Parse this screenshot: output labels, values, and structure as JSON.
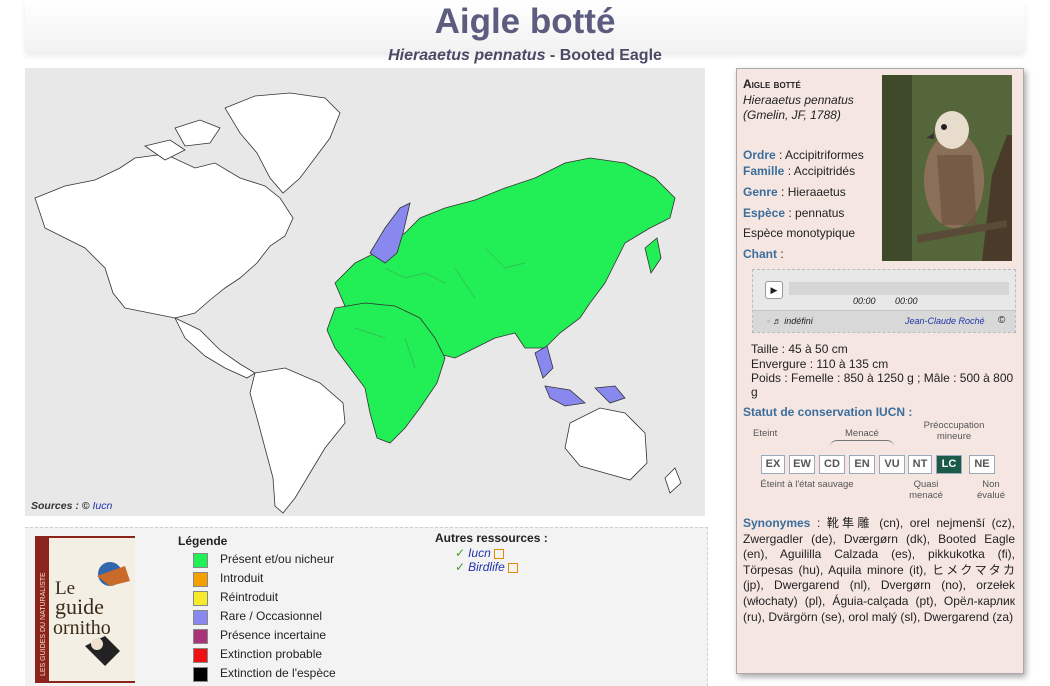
{
  "header": {
    "title": "Aigle botté",
    "subtitle_sci": "Hieraaetus pennatus",
    "subtitle_sep": " - ",
    "subtitle_common": "Booted Eagle"
  },
  "map": {
    "sources_label": "Sources : ©",
    "sources_link": "Iucn"
  },
  "legend": {
    "title": "Légende",
    "items": [
      {
        "label": "Présent et/ou nicheur",
        "color": "#22ee55"
      },
      {
        "label": "Introduit",
        "color": "#f3a000"
      },
      {
        "label": "Réintroduit",
        "color": "#f6ea2a"
      },
      {
        "label": "Rare / Occasionnel",
        "color": "#8888ee"
      },
      {
        "label": "Présence incertaine",
        "color": "#aa3377"
      },
      {
        "label": "Extinction probable",
        "color": "#ee1111"
      },
      {
        "label": "Extinction de l'espèce",
        "color": "#000000"
      }
    ]
  },
  "resources": {
    "title": "Autres ressources :",
    "items": [
      "Iucn",
      "Birdlife"
    ]
  },
  "book": {
    "title_l1": "Le",
    "title_l2": "guide",
    "title_l3": "ornitho",
    "spine": "LES GUIDES DU NATURALISTE"
  },
  "card": {
    "name": "Aigle botté",
    "sci_name": "Hieraaetus pennatus",
    "author": "(Gmelin, JF, 1788)",
    "ordre_label": "Ordre",
    "ordre_value": ": Accipitriformes",
    "famille_label": "Famille",
    "famille_value": ": Accipitridés",
    "genre_label": "Genre",
    "genre_value": ": Hieraaetus",
    "espece_label": "Espèce",
    "espece_value": ": pennatus",
    "monotypique": "Espèce monotypique",
    "chant_label": "Chant",
    "chant_value": ":",
    "player": {
      "time_current": "00:00",
      "time_total": "00:00",
      "track": "♬ indéfini",
      "author": "Jean-Claude Roché"
    },
    "taille": "Taille : 45 à 50 cm",
    "envergure": "Envergure : 110 à 135 cm",
    "poids": "Poids : Femelle : 850 à 1250 g ; Mâle : 500 à 800 g",
    "statut_label": "Statut de conservation IUCN :",
    "iucn": {
      "eteint": "Eteint",
      "menace": "Menacé",
      "preoccupation": "Préoccupation mineure",
      "eteint_sauvage": "Éteint à l'état sauvage",
      "quasi": "Quasi menacé",
      "non_evalue": "Non évalué",
      "codes": [
        "EX",
        "EW",
        "CD",
        "EN",
        "VU",
        "NT",
        "LC",
        "NE"
      ],
      "selected": "LC"
    },
    "synonymes_label": "Synonymes",
    "synonymes_text": " : 靴隼雕 (cn), orel nejmenší (cz), Zwergadler (de), Dværgørn (dk), Booted Eagle (en), Aguililla Calzada (es), pikkukotka (fi), Törpesas (hu), Aquila minore (it), ヒメクマタカ (jp), Dwergarend (nl), Dvergørn (no), orzełek (włochaty) (pl), Águia-calçada (pt), Орёл-карлик (ru), Dvärgörn (se), orol malý (sl), Dwergarend (za)"
  }
}
